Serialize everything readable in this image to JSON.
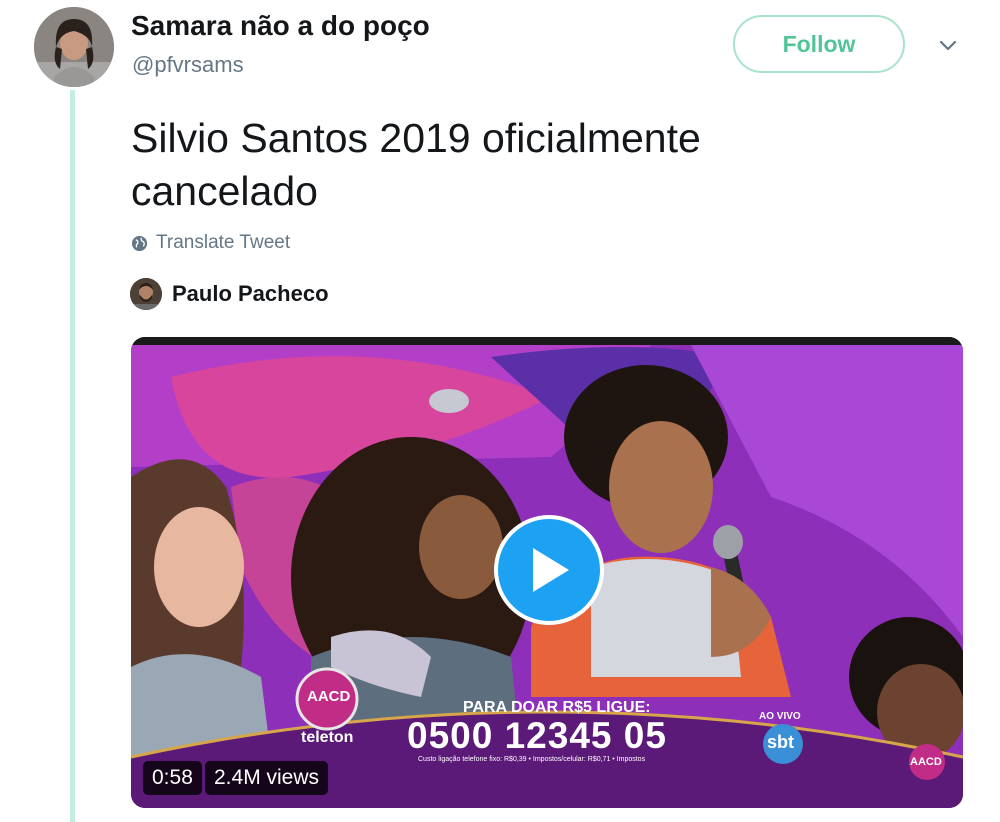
{
  "tweet": {
    "author_name": "Samara não a do poço",
    "handle": "@pfvrsams",
    "follow_label": "Follow",
    "text": "Silvio Santos 2019 oficialmente cancelado",
    "translate_label": "Translate Tweet",
    "attribution_name": "Paulo Pacheco"
  },
  "video": {
    "duration": "0:58",
    "views": "2.4M views",
    "overlay": {
      "aacd": "AACD",
      "teleton": "teleton",
      "donate_line": "PARA DOAR R$5 LIGUE:",
      "phone": "0500 12345 05",
      "fine_print": "Custo ligação telefone fixo: R$0,39 • Impostos/celular: R$0,71 • Impostos",
      "ao_vivo": "AO VIVO",
      "sbt": "sbt",
      "aacd_small": "AACD"
    }
  },
  "colors": {
    "accent_green": "#51c598",
    "thread_line": "#c4eedd",
    "play_blue": "#1da1f2",
    "banner_purple": "#5b1a78"
  },
  "icons": [
    "chevron-down-icon",
    "globe-icon",
    "play-icon"
  ]
}
